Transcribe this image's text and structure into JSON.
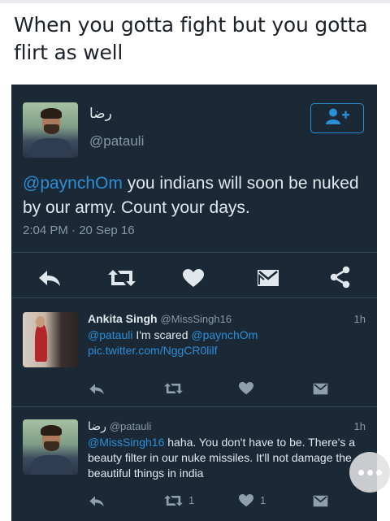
{
  "caption": "When you gotta fight but you gotta flirt as well",
  "main_tweet": {
    "name": "رضا",
    "handle": "@patauli",
    "mention": "@paynchOm",
    "text": " you indians will soon be nuked by our army. Count your days.",
    "timestamp": "2:04 PM · 20 Sep 16"
  },
  "reply1": {
    "name": "Ankita Singh",
    "handle": "@MissSingh16",
    "time": "1h",
    "mention1": "@patauli",
    "text1": " I'm scared ",
    "mention2": "@paynchOm",
    "link": " pic.twitter.com/NggCR0lilf"
  },
  "reply2": {
    "name": "رضا",
    "handle": "@patauli",
    "time": "1h",
    "mention": "@MissSingh16",
    "text": " haha. You don't have to be. There's a beauty filter in our nuke missiles. It'll not damage the beautiful things in india",
    "retweet_count": "1",
    "like_count": "1"
  },
  "colors": {
    "background": "#1b2836",
    "accent": "#2b8fd6",
    "muted": "#8899a6",
    "text": "#e1e8ed"
  },
  "icons": [
    "follow-icon",
    "reply-icon",
    "retweet-icon",
    "like-icon",
    "dm-icon",
    "share-icon",
    "more-icon"
  ]
}
